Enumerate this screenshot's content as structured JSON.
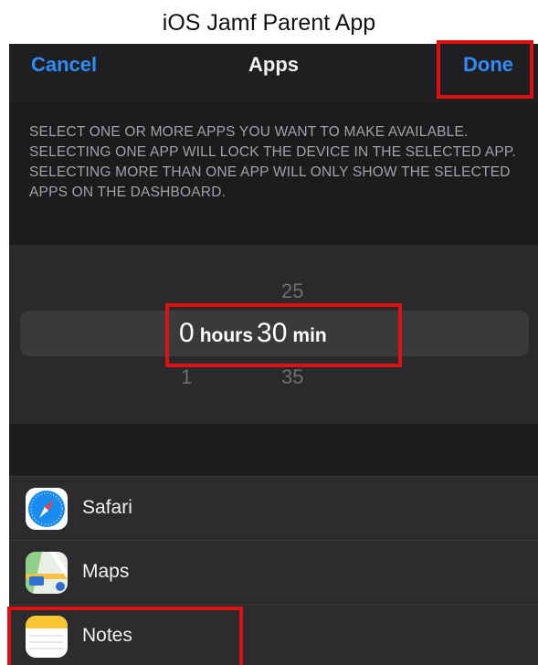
{
  "caption": "iOS Jamf Parent App",
  "navbar": {
    "cancel_label": "Cancel",
    "title": "Apps",
    "done_label": "Done"
  },
  "info_text": "SELECT ONE OR MORE APPS YOU WANT TO MAKE AVAILABLE. SELECTING ONE APP WILL LOCK THE DEVICE IN THE SELECTED APP. SELECTING MORE THAN ONE APP WILL ONLY SHOW THE SELECTED APPS ON THE DASHBOARD.",
  "picker": {
    "hours_value": "0",
    "hours_unit": "hours",
    "minutes_value": "30",
    "minutes_unit": "min",
    "minutes_above": "25",
    "minutes_below": "35",
    "hours_below": "1"
  },
  "apps": [
    {
      "label": "Safari",
      "icon": "safari-icon"
    },
    {
      "label": "Maps",
      "icon": "maps-icon"
    },
    {
      "label": "Notes",
      "icon": "notes-icon"
    }
  ],
  "colors": {
    "accent": "#2f8df5",
    "highlight": "#e01010",
    "background": "#1c1c1e"
  }
}
